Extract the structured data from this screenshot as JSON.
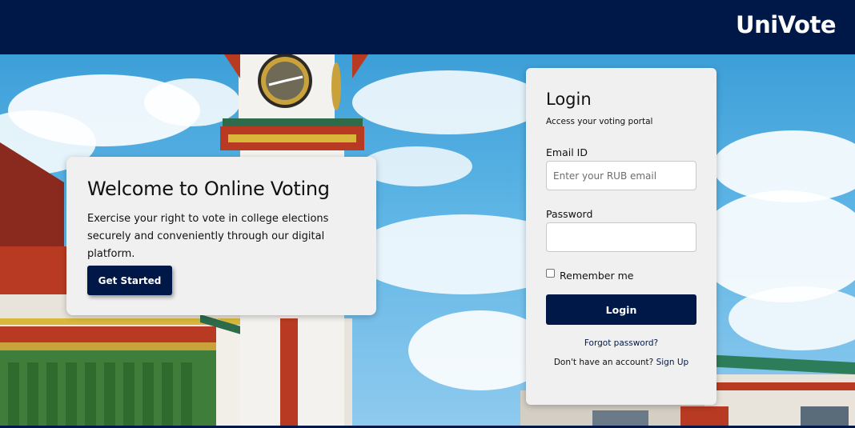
{
  "header": {
    "brand": "UniVote",
    "background_color": "#001847"
  },
  "hero": {
    "background_image": "college clock tower and traditional Bhutanese buildings under blue sky with clouds",
    "welcome": {
      "title": "Welcome to Online Voting",
      "text": "Exercise your right to vote in college elections securely and conveniently through our digital platform.",
      "button_label": "Get Started"
    }
  },
  "login": {
    "title": "Login",
    "subtitle": "Access your voting portal",
    "email_label": "Email ID",
    "email_placeholder": "Enter your RUB email",
    "email_value": "",
    "password_label": "Password",
    "password_value": "",
    "remember_label": "Remember me",
    "remember_checked": false,
    "button_label": "Login",
    "forgot_label": "Forgot password?",
    "signup_prompt": "Don't have an account?",
    "signup_link": "Sign Up",
    "accent_color": "#001847"
  }
}
